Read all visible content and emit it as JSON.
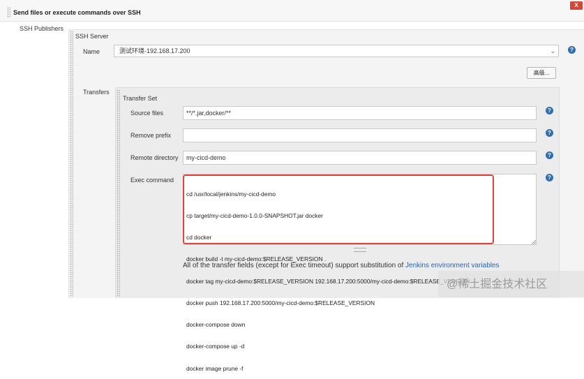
{
  "section": {
    "title": "Send files or execute commands over SSH",
    "close_label": "X"
  },
  "ssh_publishers": {
    "label": "SSH Publishers",
    "server_heading": "SSH Server",
    "name_label": "Name",
    "name_value": "测试环境-192.168.17.200",
    "advanced_button": "高级..."
  },
  "transfers": {
    "label": "Transfers",
    "set_heading": "Transfer Set",
    "source_files_label": "Source files",
    "source_files_value": "**/*.jar,docker/**",
    "remove_prefix_label": "Remove prefix",
    "remove_prefix_value": "",
    "remote_directory_label": "Remote directory",
    "remote_directory_value": "my-cicd-demo",
    "exec_command_label": "Exec command",
    "exec_command_lines": [
      "cd /usr/local/jenkins/my-cicd-demo",
      "cp target/my-cicd-demo-1.0.0-SNAPSHOT.jar docker",
      "cd docker",
      "docker build -t my-cicd-demo:$RELEASE_VERSION .",
      "docker tag my-cicd-demo:$RELEASE_VERSION 192.168.17.200:5000/my-cicd-demo:$RELEASE_VERSION",
      "docker push 192.168.17.200:5000/my-cicd-demo:$RELEASE_VERSION",
      "docker-compose down",
      "docker-compose up -d",
      "docker image prune -f"
    ],
    "footnote_text": "All of the transfer fields (except for Exec timeout) support substitution of ",
    "footnote_link": "Jenkins environment variables"
  },
  "help_icon_glyph": "?",
  "select_chevron": "⌄",
  "watermark": "@稀土掘金技术社区",
  "colors": {
    "help": "#2f6fb0",
    "highlight": "#e0443a",
    "close": "#d24939",
    "link": "#2a64ae"
  }
}
